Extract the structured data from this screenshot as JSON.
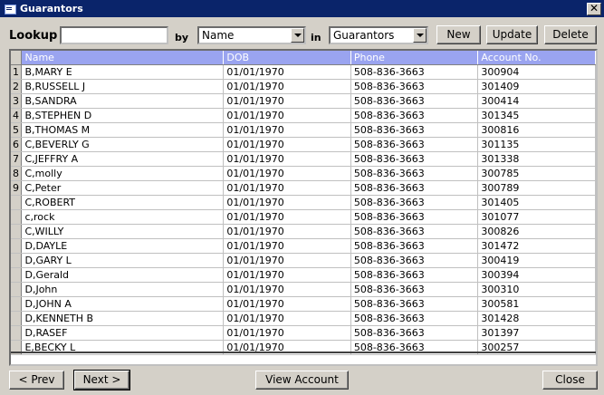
{
  "window": {
    "title": "Guarantors",
    "close_glyph": "✕"
  },
  "toolbar": {
    "lookup_label": "Lookup",
    "lookup_value": "",
    "by_label": "by",
    "by_selected": "Name",
    "in_label": "in",
    "in_selected": "Guarantors",
    "new_label": "New",
    "update_label": "Update",
    "delete_label": "Delete"
  },
  "table": {
    "columns": [
      "Name",
      "DOB",
      "Phone",
      "Account No."
    ],
    "rows": [
      {
        "idx": "1",
        "name": "B,MARY E",
        "dob": "01/01/1970",
        "phone": "508-836-3663",
        "acct": "300904"
      },
      {
        "idx": "2",
        "name": "B,RUSSELL J",
        "dob": "01/01/1970",
        "phone": "508-836-3663",
        "acct": "301409"
      },
      {
        "idx": "3",
        "name": "B,SANDRA",
        "dob": "01/01/1970",
        "phone": "508-836-3663",
        "acct": "300414"
      },
      {
        "idx": "4",
        "name": "B,STEPHEN D",
        "dob": "01/01/1970",
        "phone": "508-836-3663",
        "acct": "301345"
      },
      {
        "idx": "5",
        "name": "B,THOMAS M",
        "dob": "01/01/1970",
        "phone": "508-836-3663",
        "acct": "300816"
      },
      {
        "idx": "6",
        "name": "C,BEVERLY G",
        "dob": "01/01/1970",
        "phone": "508-836-3663",
        "acct": "301135"
      },
      {
        "idx": "7",
        "name": "C,JEFFRY A",
        "dob": "01/01/1970",
        "phone": "508-836-3663",
        "acct": "301338"
      },
      {
        "idx": "8",
        "name": "C,molly",
        "dob": "01/01/1970",
        "phone": "508-836-3663",
        "acct": "300785"
      },
      {
        "idx": "9",
        "name": "C,Peter",
        "dob": "01/01/1970",
        "phone": "508-836-3663",
        "acct": "300789"
      },
      {
        "idx": "",
        "name": "C,ROBERT",
        "dob": "01/01/1970",
        "phone": "508-836-3663",
        "acct": "301405"
      },
      {
        "idx": "",
        "name": "c,rock",
        "dob": "01/01/1970",
        "phone": "508-836-3663",
        "acct": "301077"
      },
      {
        "idx": "",
        "name": "C,WILLY",
        "dob": "01/01/1970",
        "phone": "508-836-3663",
        "acct": "300826"
      },
      {
        "idx": "",
        "name": "D,DAYLE",
        "dob": "01/01/1970",
        "phone": "508-836-3663",
        "acct": "301472"
      },
      {
        "idx": "",
        "name": "D,GARY L",
        "dob": "01/01/1970",
        "phone": "508-836-3663",
        "acct": "300419"
      },
      {
        "idx": "",
        "name": "D,Gerald",
        "dob": "01/01/1970",
        "phone": "508-836-3663",
        "acct": "300394"
      },
      {
        "idx": "",
        "name": "D,John",
        "dob": "01/01/1970",
        "phone": "508-836-3663",
        "acct": "300310"
      },
      {
        "idx": "",
        "name": "D,JOHN A",
        "dob": "01/01/1970",
        "phone": "508-836-3663",
        "acct": "300581"
      },
      {
        "idx": "",
        "name": "D,KENNETH B",
        "dob": "01/01/1970",
        "phone": "508-836-3663",
        "acct": "301428"
      },
      {
        "idx": "",
        "name": "D,RASEF",
        "dob": "01/01/1970",
        "phone": "508-836-3663",
        "acct": "301397"
      },
      {
        "idx": "",
        "name": "E,BECKY L",
        "dob": "01/01/1970",
        "phone": "508-836-3663",
        "acct": "300257"
      }
    ]
  },
  "footer": {
    "prev_label": "< Prev",
    "next_label": "Next >",
    "view_account_label": "View Account",
    "close_label": "Close"
  },
  "colors": {
    "titlebar": "#0a246a",
    "header": "#9aa4f0",
    "face": "#d4d0c8"
  }
}
